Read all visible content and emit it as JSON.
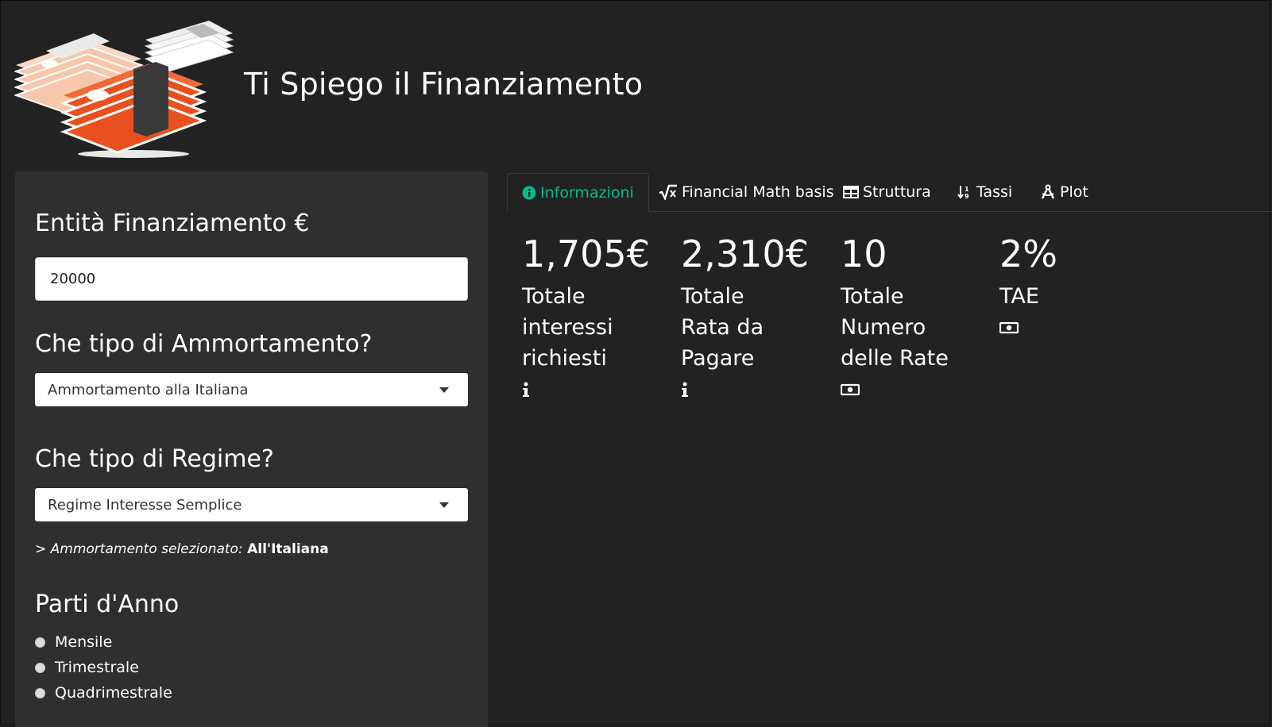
{
  "header": {
    "title": "Ti Spiego il Finanziamento",
    "logo_icon": "money-stacks-icon"
  },
  "sidebar": {
    "amount_label": "Entità Finanziamento €",
    "amount_value": "20000",
    "ammortamento_label": "Che tipo di Ammortamento?",
    "ammortamento_selected": "Ammortamento alla Italiana",
    "regime_label": "Che tipo di Regime?",
    "regime_selected": "Regime Interesse Semplice",
    "note_prefix": "> ",
    "note_italic": "Ammortamento selezionato:",
    "note_bold": "All'Italiana",
    "parti_label": "Parti d'Anno",
    "parti_options": [
      "Mensile",
      "Trimestrale",
      "Quadrimestrale"
    ]
  },
  "tabs": [
    {
      "label": "Informazioni",
      "icon": "info-circle-icon",
      "active": true
    },
    {
      "label": "Financial Math basis",
      "icon": "square-root-icon",
      "active": false
    },
    {
      "label": "Struttura",
      "icon": "table-icon",
      "active": false
    },
    {
      "label": "Tassi",
      "icon": "sort-numeric-icon",
      "active": false
    },
    {
      "label": "Plot",
      "icon": "compass-drafting-icon",
      "active": false
    }
  ],
  "stats": [
    {
      "value": "1,705€",
      "label": "Totale interessi richiesti",
      "icon": "info-icon"
    },
    {
      "value": "2,310€",
      "label": "Totale Rata da Pagare",
      "icon": "info-icon"
    },
    {
      "value": "10",
      "label": "Totale Numero delle Rate",
      "icon": "money-bill-icon"
    },
    {
      "value": "2%",
      "label": "TAE",
      "icon": "money-bill-icon"
    }
  ],
  "colors": {
    "background": "#222222",
    "sidebar": "#2f2f2f",
    "accent": "#00bc8c",
    "logo_orange": "#e8501f",
    "logo_peach": "#f7c7ab"
  }
}
